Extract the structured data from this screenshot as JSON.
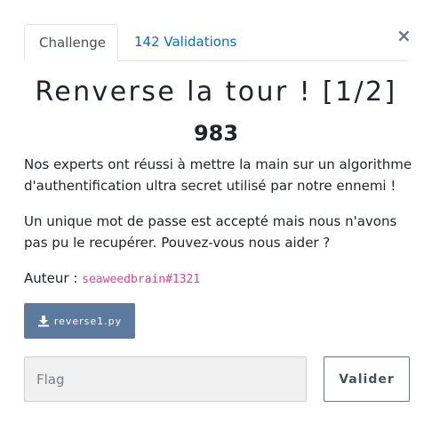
{
  "modal": {
    "close_label": "×"
  },
  "tabs": [
    {
      "label": "Challenge",
      "active": true
    },
    {
      "label": "142 Validations",
      "active": false
    }
  ],
  "challenge": {
    "title": "Renverse la tour ! [1/2]",
    "points": "983",
    "description": [
      "Nos experts ont réussi à mettre la main sur un algorithme d'authentification ultra secret utilisé par notre ennemi !",
      "Un unique mot de passe est accepté mais nous n'avons pas pu le recupérer. Pouvez-vous nous aider ?"
    ],
    "author_label": "Auteur : ",
    "author_name": "seaweedbrain#1321"
  },
  "download": {
    "icon": "download-icon",
    "filename": "reverse1.py"
  },
  "flag_form": {
    "placeholder": "Flag",
    "value": "",
    "submit_label": "Valider"
  },
  "colors": {
    "link": "#0a6ebd",
    "author": "#e83e8c",
    "download_button": "#5c7a9e"
  }
}
